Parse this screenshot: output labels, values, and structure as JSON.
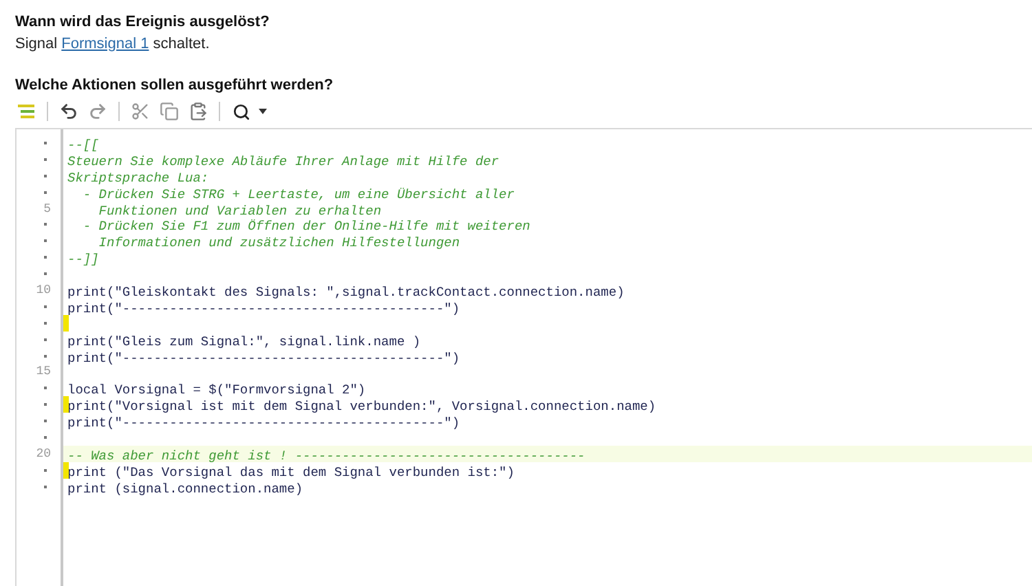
{
  "trigger": {
    "heading": "Wann wird das Ereignis ausgelöst?",
    "before": "Signal",
    "link": "Formsignal 1",
    "after": "schaltet."
  },
  "actions": {
    "heading": "Welche Aktionen sollen ausgeführt werden?"
  },
  "editor": {
    "lines": [
      {
        "kind": "comment",
        "text": "--[[",
        "changed": false,
        "highlighted": false
      },
      {
        "kind": "comment",
        "text": "Steuern Sie komplexe Abläufe Ihrer Anlage mit Hilfe der",
        "changed": false,
        "highlighted": false
      },
      {
        "kind": "comment",
        "text": "Skriptsprache Lua:",
        "changed": false,
        "highlighted": false
      },
      {
        "kind": "comment",
        "text": "  - Drücken Sie STRG + Leertaste, um eine Übersicht aller",
        "changed": false,
        "highlighted": false
      },
      {
        "kind": "comment",
        "text": "    Funktionen und Variablen zu erhalten",
        "number": "5",
        "changed": false,
        "highlighted": false
      },
      {
        "kind": "comment",
        "text": "  - Drücken Sie F1 zum Öffnen der Online-Hilfe mit weiteren",
        "changed": false,
        "highlighted": false
      },
      {
        "kind": "comment",
        "text": "    Informationen und zusätzlichen Hilfestellungen",
        "changed": false,
        "highlighted": false
      },
      {
        "kind": "comment",
        "text": "--]]",
        "changed": false,
        "highlighted": false
      },
      {
        "kind": "blank",
        "changed": false,
        "highlighted": false
      },
      {
        "kind": "code",
        "text": "print(\"Gleiskontakt des Signals: \",signal.trackContact.connection.name)",
        "number": "10",
        "changed": false,
        "highlighted": false
      },
      {
        "kind": "code",
        "text": "print(\"-----------------------------------------\")",
        "changed": false,
        "highlighted": false
      },
      {
        "kind": "blank",
        "changed": true,
        "highlighted": false
      },
      {
        "kind": "code",
        "text": "print(\"Gleis zum Signal:\", signal.link.name )",
        "changed": false,
        "highlighted": false
      },
      {
        "kind": "code",
        "text": "print(\"-----------------------------------------\")",
        "changed": false,
        "highlighted": false
      },
      {
        "kind": "blank",
        "number": "15",
        "changed": false,
        "highlighted": false
      },
      {
        "kind": "code",
        "text": "local Vorsignal = $(\"Formvorsignal 2\")",
        "changed": false,
        "highlighted": false
      },
      {
        "kind": "code",
        "text": "print(\"Vorsignal ist mit dem Signal verbunden:\", Vorsignal.connection.name)",
        "changed": true,
        "highlighted": false
      },
      {
        "kind": "code",
        "text": "print(\"-----------------------------------------\")",
        "changed": false,
        "highlighted": false
      },
      {
        "kind": "blank",
        "changed": false,
        "highlighted": false
      },
      {
        "kind": "comment",
        "text": "-- Was aber nicht geht ist ! -------------------------------------",
        "number": "20",
        "changed": false,
        "highlighted": true
      },
      {
        "kind": "code",
        "text": "print (\"Das Vorsignal das mit dem Signal verbunden ist:\")",
        "changed": true,
        "highlighted": false
      },
      {
        "kind": "code",
        "text": "print (signal.connection.name)",
        "changed": false,
        "highlighted": false
      }
    ]
  }
}
